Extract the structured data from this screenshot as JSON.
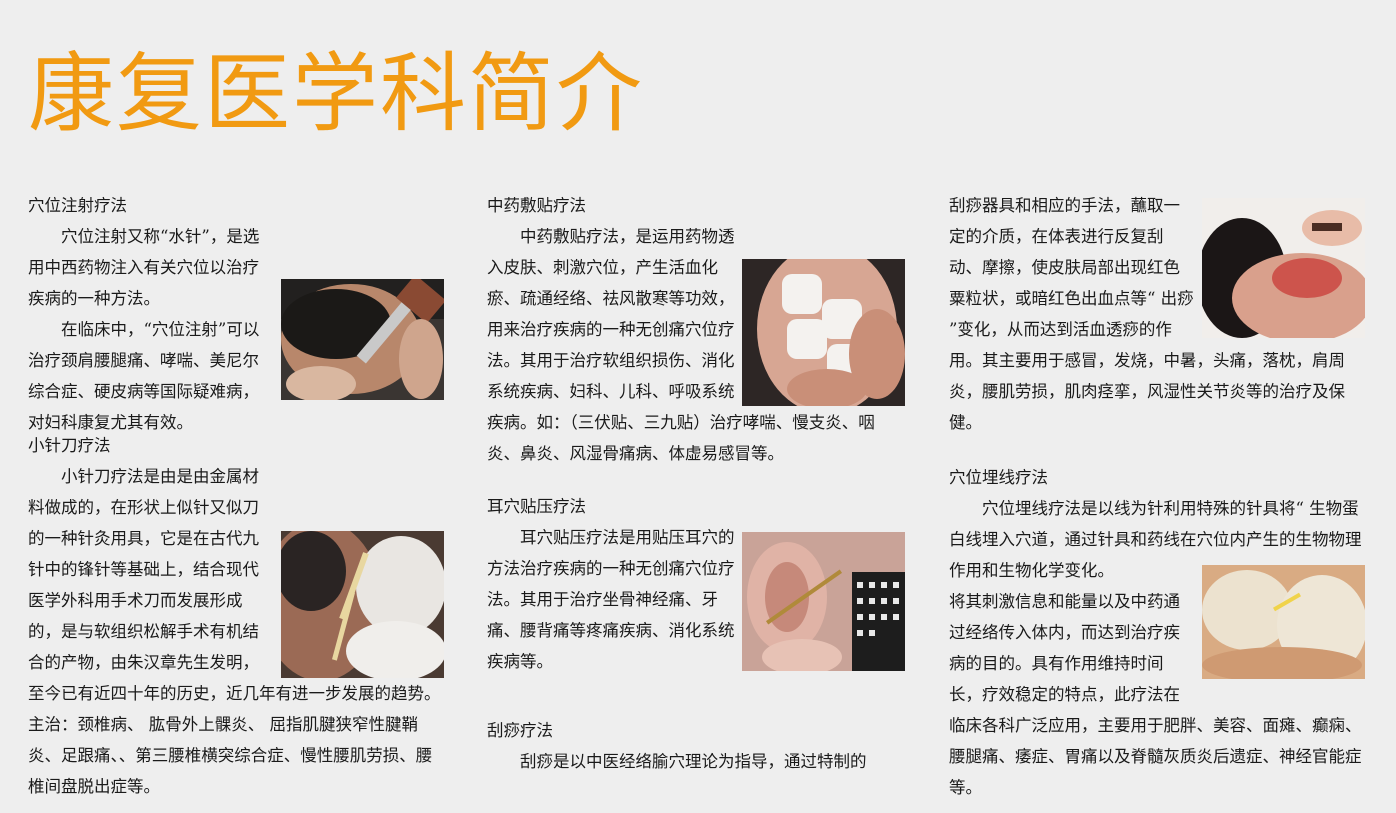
{
  "title": "康复医学科简介",
  "col1": {
    "s1": {
      "heading": "穴位注射疗法",
      "p1": "穴位注射又称“水针”，是选用中西药物注入有关穴位以治疗疾病的一种方法。",
      "p2": "在临床中，“穴位注射”可以治疗颈肩腰腿痛、哮喘、美尼尔综合症、硬皮病等国际疑难病，对妇科康复尤其有效。"
    },
    "s2": {
      "heading": "小针刀疗法",
      "p1": "小针刀疗法是由是由金属材料做成的，在形状上似针又似刀的一种针灸用具，它是在古代九针中的锋针等基础上，结合现代医学外科用手术刀而发展形成的，是与软组织松解手术有机结合的产物，由朱汉章先生发明，至今已有近四十年的历史，近几年有进一步发展的趋势。主治：颈椎病、 肱骨外上髁炎、 屈指肌腱狭窄性腱鞘炎、足跟痛、、第三腰椎横突综合症、慢性腰肌劳损、腰椎间盘脱出症等。"
    }
  },
  "col2": {
    "s1": {
      "heading": "中药敷贴疗法",
      "p1": "中药敷贴疗法，是运用药物透入皮肤、刺激穴位，产生活血化瘀、疏通经络、祛风散寒等功效，用来治疗疾病的一种无创痛穴位疗法。其用于治疗软组织损伤、消化系统疾病、妇科、儿科、呼吸系统疾病。如：（三伏贴、三九贴）治疗哮喘、慢支炎、咽炎、鼻炎、风湿骨痛病、体虚易感冒等。"
    },
    "s2": {
      "heading": "耳穴贴压疗法",
      "p1": "耳穴贴压疗法是用贴压耳穴的方法治疗疾病的一种无创痛穴位疗法。其用于治疗坐骨神经痛、牙痛、腰背痛等疼痛疾病、消化系统疾病等。"
    },
    "s3": {
      "heading": "刮痧疗法",
      "p1": "刮痧是以中医经络腧穴理论为指导，通过特制的"
    }
  },
  "col3": {
    "s1": {
      "p1": "刮痧器具和相应的手法，蘸取一定的介质，在体表进行反复刮动、摩擦，使皮肤局部出现红色粟粒状，或暗红色出血点等“ 出痧 ”变化，从而达到活血透痧的作用。其主要用于感冒，发烧，中暑，头痛，落枕，肩周炎，腰肌劳损，肌肉痉挛，风湿性关节炎等的治疗及保健。"
    },
    "s2": {
      "heading": "穴位埋线疗法",
      "p1": "穴位埋线疗法是以线为针利用特殊的针具将“ 生物蛋白线埋入穴道，通过针具和药线在穴位内产生的生物物理作用和生物化学变化。",
      "p2": "将其刺激信息和能量以及中药通过经络传入体内，而达到治疗疾病的目的。具有作用维持时间长，疗效稳定的特点，此疗法在临床各科广泛应用，主要用于肥胖、美容、面瘫、癫痫、腰腿痛、痿症、胃痛以及脊髓灰质炎后遗症、神经官能症等。"
    }
  },
  "photos": {
    "injection": "acupoint-injection-photo",
    "needle_knife": "needle-knife-photo",
    "herbal_patch": "herbal-patch-photo",
    "ear_press": "ear-acupressure-photo",
    "scraping": "gua-sha-photo",
    "catgut": "catgut-embedding-photo"
  },
  "colors": {
    "title": "#f19a12",
    "background": "#eeeeee",
    "text": "#1a1a1a"
  }
}
